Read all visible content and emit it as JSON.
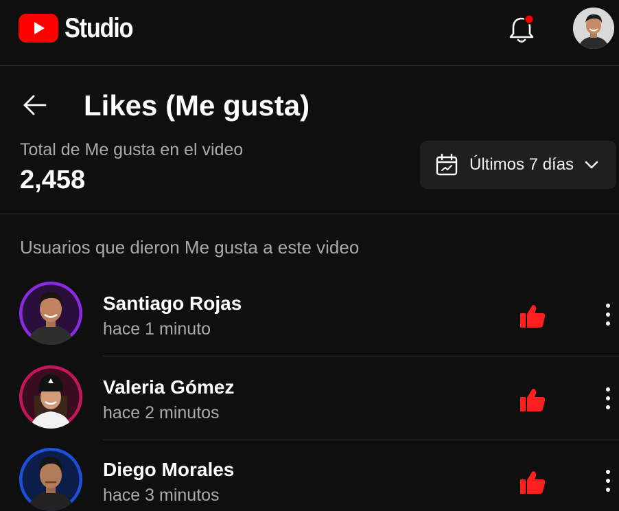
{
  "app": {
    "logo_text": "Studio",
    "brand_color": "#ff0000",
    "notification_dot_color": "#ff0000"
  },
  "header": {
    "title": "Likes (Me gusta)"
  },
  "summary": {
    "label": "Total de Me gusta en el video",
    "value": "2,458"
  },
  "date_filter": {
    "label": "Últimos 7 días",
    "icon": "calendar-icon"
  },
  "section": {
    "heading": "Usuarios que dieron Me gusta a este video"
  },
  "likers": [
    {
      "name": "Santiago Rojas",
      "time": "hace 1 minuto",
      "ring_color": "#8a2be2"
    },
    {
      "name": "Valeria Gómez",
      "time": "hace 2 minutos",
      "ring_color": "#c2185b"
    },
    {
      "name": "Diego Morales",
      "time": "hace 3 minutos",
      "ring_color": "#1e4fd8"
    }
  ],
  "like_icon_color": "#ff1f1f"
}
